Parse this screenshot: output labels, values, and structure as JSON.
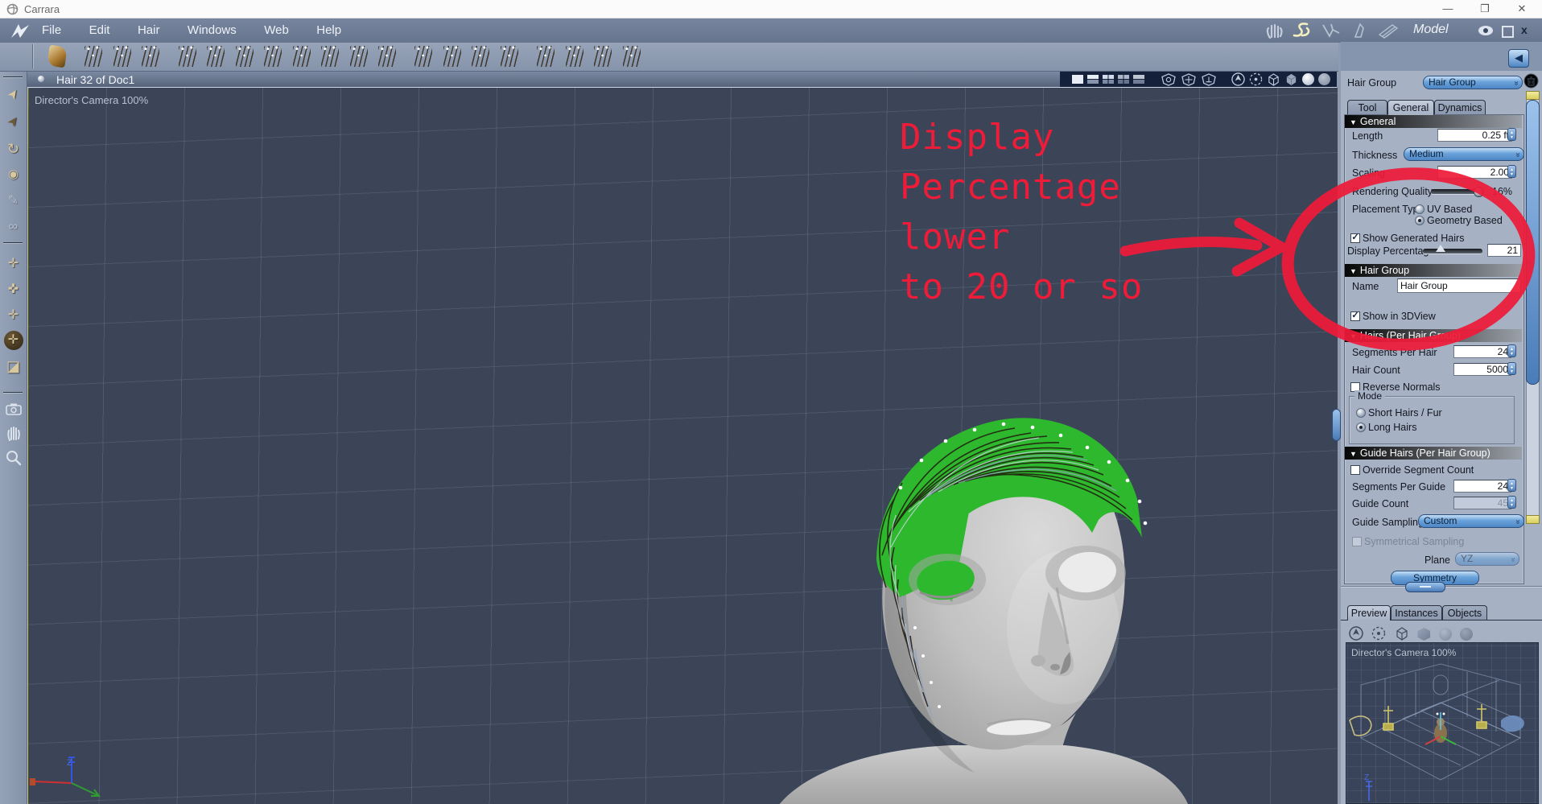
{
  "window": {
    "title": "Carrara"
  },
  "menu": {
    "items": [
      "File",
      "Edit",
      "Hair",
      "Windows",
      "Web",
      "Help"
    ],
    "room_label": "Model"
  },
  "viewport": {
    "title": "Hair 32 of Doc1",
    "camera_label": "Director's Camera 100%",
    "axis_z_label": "Z"
  },
  "annotation": {
    "lines": [
      "Display",
      "Percentage",
      "lower",
      "to 20 or so"
    ],
    "color": "#ee1b39"
  },
  "panel": {
    "hair_group_selector": {
      "label": "Hair Group",
      "value": "Hair Group"
    },
    "tabs": [
      {
        "label": "Tool"
      },
      {
        "label": "General"
      },
      {
        "label": "Dynamics"
      }
    ],
    "active_tab": "General",
    "general": {
      "title": "General",
      "length_label": "Length",
      "length_value": "0.25 ft",
      "thickness_label": "Thickness",
      "thickness_value": "Medium",
      "scaling_label": "Scaling",
      "scaling_value": "2.00",
      "rendering_label": "Rendering Quality",
      "rendering_value": "16%",
      "placement_label": "Placement Type",
      "placement_options": [
        "UV Based",
        "Geometry Based"
      ],
      "placement_selected": "Geometry Based",
      "show_generated_label": "Show Generated Hairs",
      "show_generated_checked": true,
      "display_pct_label": "Display Percentage",
      "display_pct_value": "21"
    },
    "hair_group_section": {
      "title": "Hair Group",
      "name_label": "Name",
      "name_value": "Hair Group",
      "show_label": "Show in 3DView",
      "show_checked": true
    },
    "hairs_section": {
      "title": "Hairs (Per Hair Group)",
      "segments_label": "Segments Per Hair",
      "segments_value": "24",
      "count_label": "Hair Count",
      "count_value": "5000",
      "reverse_label": "Reverse Normals",
      "reverse_checked": false,
      "mode_label": "Mode",
      "mode_options": [
        "Short Hairs / Fur",
        "Long Hairs"
      ],
      "mode_selected": "Long Hairs"
    },
    "guide_section": {
      "title": "Guide Hairs (Per Hair Group)",
      "override_label": "Override Segment Count",
      "override_checked": false,
      "spg_label": "Segments Per Guide",
      "spg_value": "24",
      "gc_label": "Guide Count",
      "gc_value": "45",
      "gc_disabled": true,
      "sampling_label": "Guide Sampling",
      "sampling_value": "Custom",
      "symmetrical_label": "Symmetrical Sampling",
      "symmetrical_checked": false,
      "plane_label": "Plane",
      "plane_value": "YZ",
      "plane_disabled": true,
      "symmetry_button": "Symmetry"
    },
    "bottom_tabs": [
      {
        "label": "Preview"
      },
      {
        "label": "Instances"
      },
      {
        "label": "Objects"
      }
    ],
    "active_bottom_tab": "Preview",
    "preview": {
      "camera_label": "Director's Camera 100%",
      "axis_z_label": "Z"
    }
  },
  "colors": {
    "annotation_red": "#ee1b39",
    "hair_green": "#2eb82e",
    "viewport_bg": "#3b4557",
    "panel_bg": "#a6b1c4",
    "accent_blue": "#4d86c4"
  }
}
